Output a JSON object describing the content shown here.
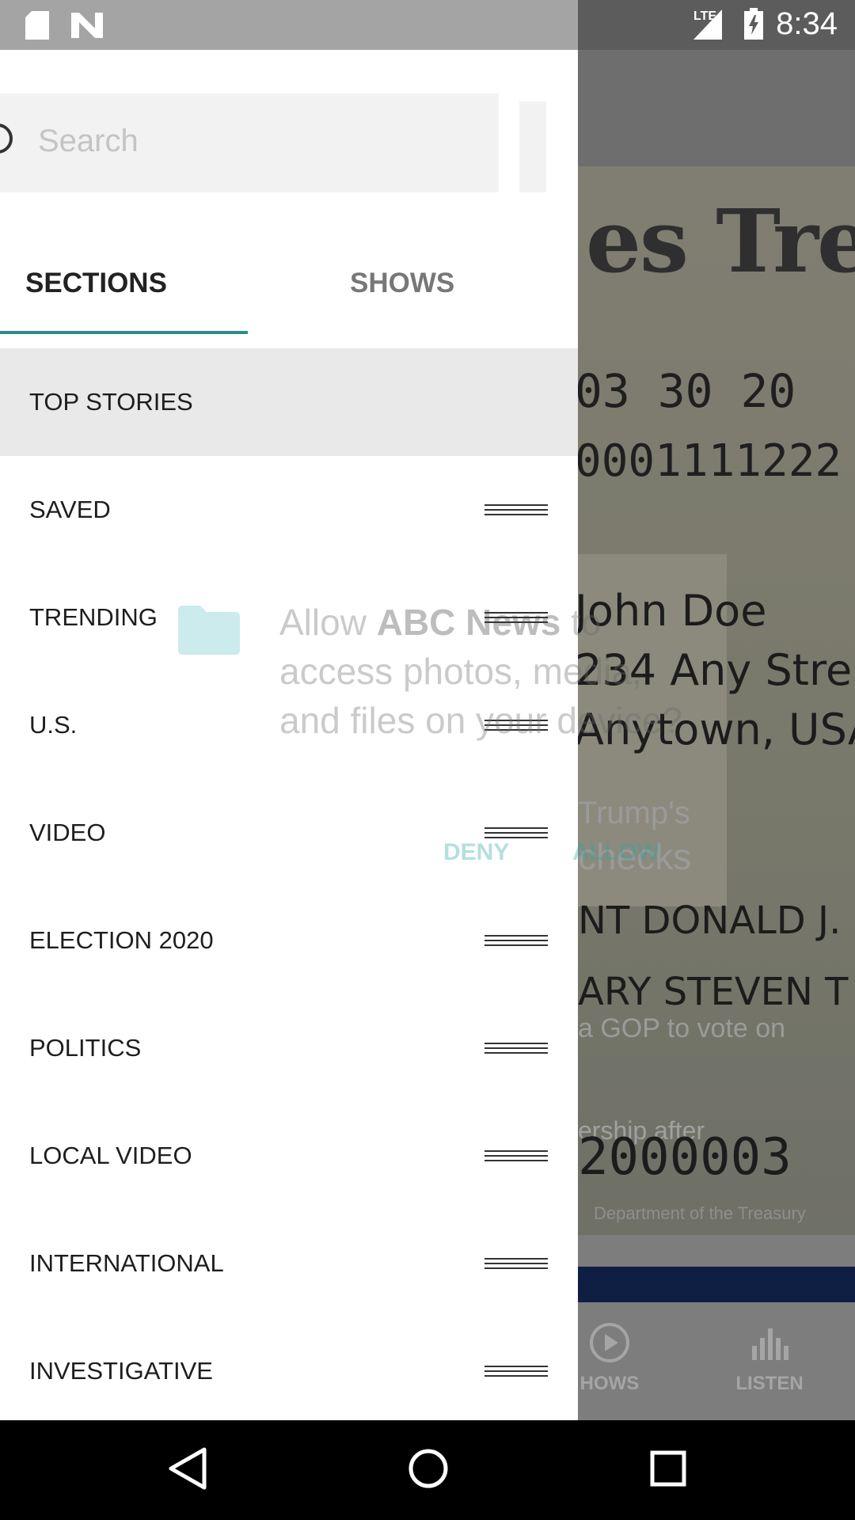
{
  "status_bar": {
    "time": "8:34",
    "network": "LTE",
    "icons": [
      "sd-card-icon",
      "app-n-icon",
      "signal-icon",
      "battery-charging-icon"
    ]
  },
  "background": {
    "masthead": "es Treas",
    "check_line_1": "03  30  20",
    "check_line_2": "0001111222",
    "address": [
      "John Doe",
      "234 Any Stre",
      "Anytown, USA"
    ],
    "caption_1": "Trump's",
    "caption_2": "checks",
    "payee_1": "NT DONALD J.",
    "payee_2": "ARY STEVEN T",
    "caption_3": "a GOP to vote on",
    "caption_4": "ership after",
    "check_number": "2000003",
    "footer_text": "Department of the Treasury",
    "bottom_nav": [
      {
        "label": "HOWS",
        "icon": "play-circle-icon"
      },
      {
        "label": "LISTEN",
        "icon": "podcast-icon"
      }
    ]
  },
  "permission_dialog": {
    "text_prefix": "Allow ",
    "app_name": "ABC News",
    "text_suffix": " to access photos, media, and files on your device?",
    "deny_label": "DENY",
    "allow_label": "ALLOW"
  },
  "drawer": {
    "search_placeholder": "Search",
    "tabs": [
      {
        "label": "SECTIONS",
        "active": true
      },
      {
        "label": "SHOWS",
        "active": false
      }
    ],
    "sections": [
      {
        "label": "TOP STORIES",
        "active": true,
        "draggable": false
      },
      {
        "label": "SAVED",
        "active": false,
        "draggable": true
      },
      {
        "label": "TRENDING",
        "active": false,
        "draggable": true
      },
      {
        "label": "U.S.",
        "active": false,
        "draggable": true
      },
      {
        "label": "VIDEO",
        "active": false,
        "draggable": true
      },
      {
        "label": "ELECTION 2020",
        "active": false,
        "draggable": true
      },
      {
        "label": "POLITICS",
        "active": false,
        "draggable": true
      },
      {
        "label": "LOCAL VIDEO",
        "active": false,
        "draggable": true
      },
      {
        "label": "INTERNATIONAL",
        "active": false,
        "draggable": true
      },
      {
        "label": "INVESTIGATIVE",
        "active": false,
        "draggable": true
      }
    ]
  },
  "colors": {
    "accent": "#2a8e8a",
    "active_row": "#e9e9e9",
    "scrim": "#7d7d7d"
  }
}
